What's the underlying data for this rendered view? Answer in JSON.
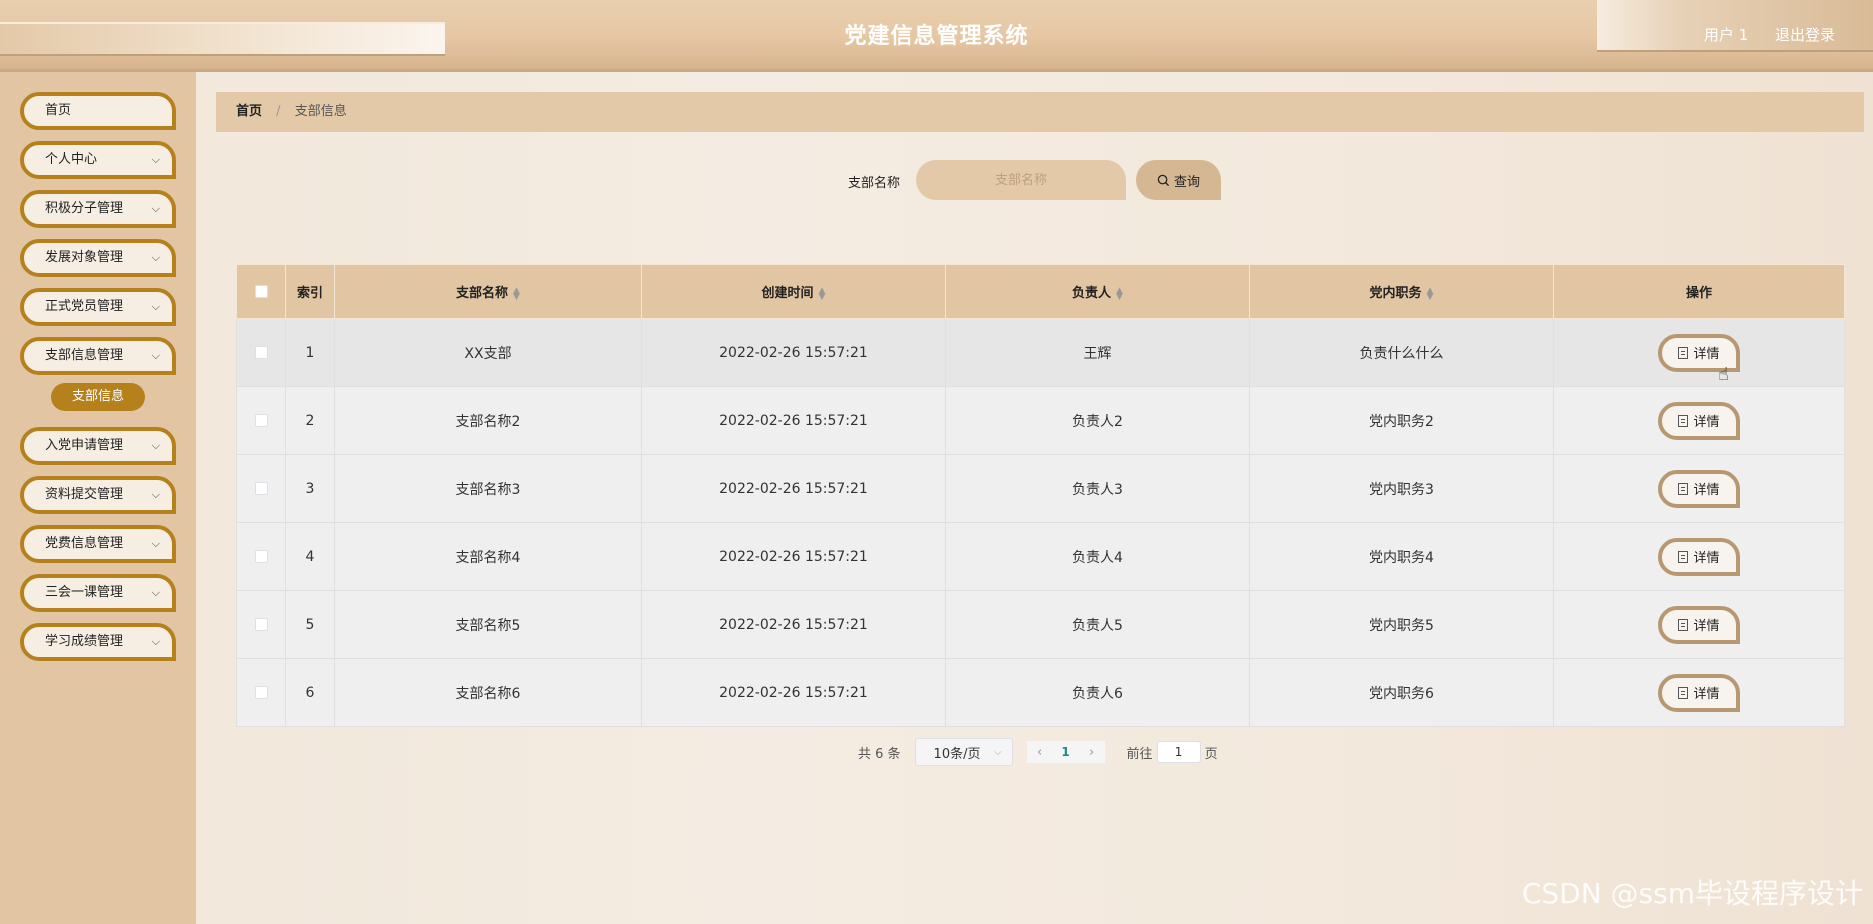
{
  "header": {
    "title": "党建信息管理系统",
    "user": "用户 1",
    "logout": "退出登录"
  },
  "sidebar": {
    "items": [
      {
        "label": "首页",
        "has_arrow": false
      },
      {
        "label": "个人中心",
        "has_arrow": true
      },
      {
        "label": "积极分子管理",
        "has_arrow": true
      },
      {
        "label": "发展对象管理",
        "has_arrow": true
      },
      {
        "label": "正式党员管理",
        "has_arrow": true
      },
      {
        "label": "支部信息管理",
        "has_arrow": true
      },
      {
        "label": "入党申请管理",
        "has_arrow": true
      },
      {
        "label": "资料提交管理",
        "has_arrow": true
      },
      {
        "label": "党费信息管理",
        "has_arrow": true
      },
      {
        "label": "三会一课管理",
        "has_arrow": true
      },
      {
        "label": "学习成绩管理",
        "has_arrow": true
      }
    ],
    "active_sub": "支部信息"
  },
  "breadcrumb": {
    "home": "首页",
    "separator": "/",
    "current": "支部信息"
  },
  "search": {
    "label": "支部名称",
    "placeholder": "支部名称",
    "button": "查询"
  },
  "table": {
    "headers": {
      "index": "索引",
      "name": "支部名称",
      "created": "创建时间",
      "leader": "负责人",
      "duty": "党内职务",
      "action": "操作"
    },
    "detail_label": "详情",
    "rows": [
      {
        "index": "1",
        "name": "XX支部",
        "created": "2022-02-26 15:57:21",
        "leader": "王辉",
        "duty": "负责什么什么"
      },
      {
        "index": "2",
        "name": "支部名称2",
        "created": "2022-02-26 15:57:21",
        "leader": "负责人2",
        "duty": "党内职务2"
      },
      {
        "index": "3",
        "name": "支部名称3",
        "created": "2022-02-26 15:57:21",
        "leader": "负责人3",
        "duty": "党内职务3"
      },
      {
        "index": "4",
        "name": "支部名称4",
        "created": "2022-02-26 15:57:21",
        "leader": "负责人4",
        "duty": "党内职务4"
      },
      {
        "index": "5",
        "name": "支部名称5",
        "created": "2022-02-26 15:57:21",
        "leader": "负责人5",
        "duty": "党内职务5"
      },
      {
        "index": "6",
        "name": "支部名称6",
        "created": "2022-02-26 15:57:21",
        "leader": "负责人6",
        "duty": "党内职务6"
      }
    ]
  },
  "pagination": {
    "total": "共 6 条",
    "page_size": "10条/页",
    "current_page": "1",
    "goto_prefix": "前往",
    "goto_value": "1",
    "goto_suffix": "页"
  },
  "watermark": "CSDN @ssm毕设程序设计",
  "colors": {
    "accent": "#b6801c",
    "sidebar_bg": "#e2c6a3",
    "table_header_bg": "#e2c6a3"
  }
}
